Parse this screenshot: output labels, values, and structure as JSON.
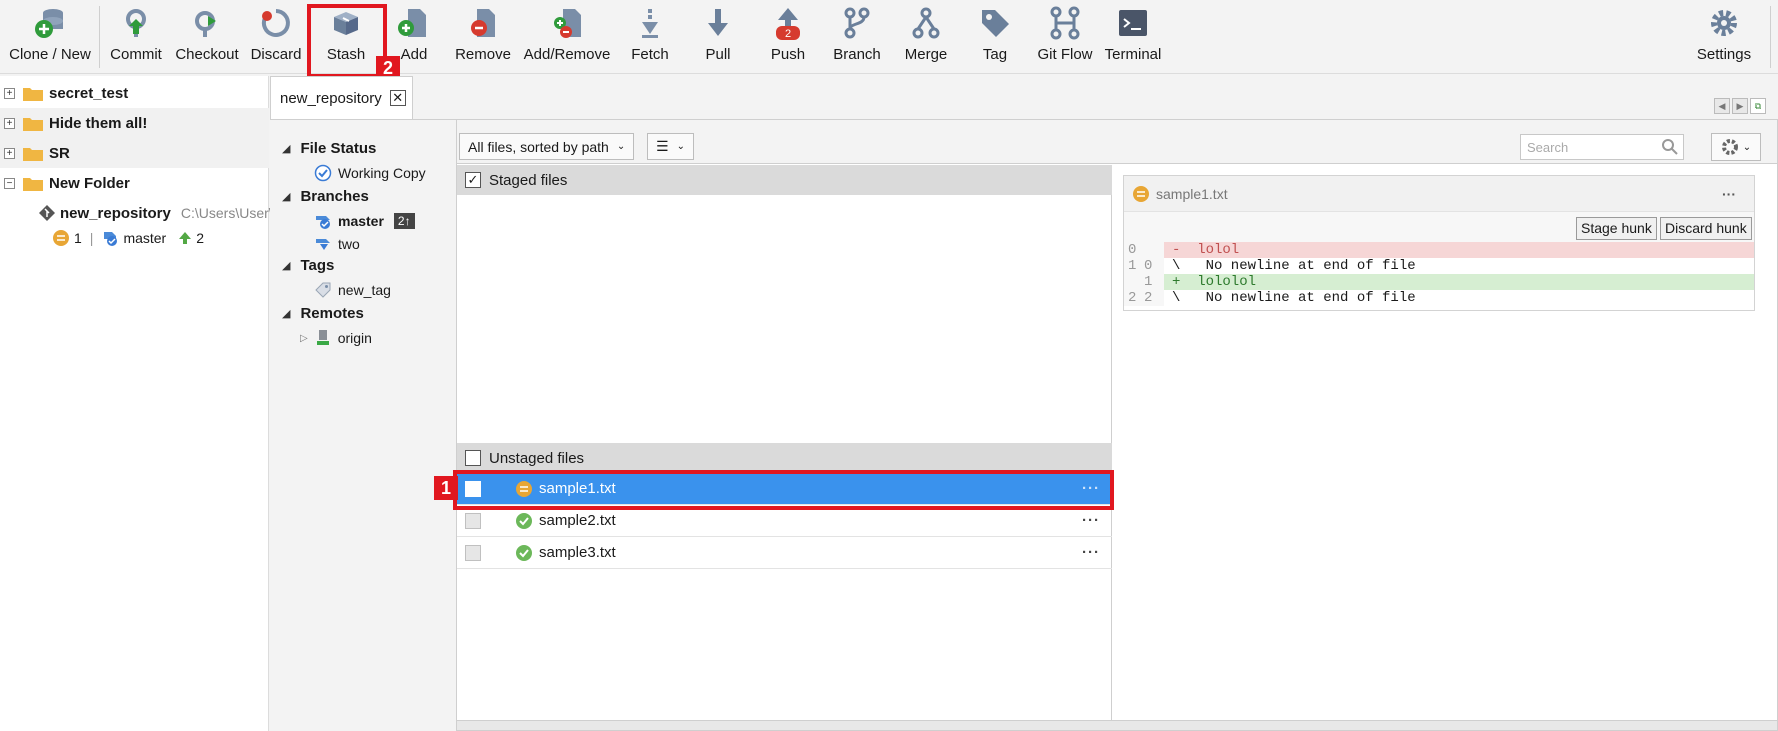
{
  "toolbar": {
    "buttons": [
      {
        "id": "clone",
        "label": "Clone / New"
      },
      {
        "id": "commit",
        "label": "Commit"
      },
      {
        "id": "checkout",
        "label": "Checkout"
      },
      {
        "id": "discard",
        "label": "Discard"
      },
      {
        "id": "stash",
        "label": "Stash"
      },
      {
        "id": "add",
        "label": "Add"
      },
      {
        "id": "remove",
        "label": "Remove"
      },
      {
        "id": "addremove",
        "label": "Add/Remove"
      },
      {
        "id": "fetch",
        "label": "Fetch"
      },
      {
        "id": "pull",
        "label": "Pull"
      },
      {
        "id": "push",
        "label": "Push",
        "badge": "2"
      },
      {
        "id": "branch",
        "label": "Branch"
      },
      {
        "id": "merge",
        "label": "Merge"
      },
      {
        "id": "tag",
        "label": "Tag"
      },
      {
        "id": "gitflow",
        "label": "Git Flow"
      },
      {
        "id": "terminal",
        "label": "Terminal"
      },
      {
        "id": "settings",
        "label": "Settings"
      }
    ]
  },
  "annotations": {
    "stash_step": "2",
    "file_step": "1",
    "color": "#e1171f"
  },
  "repo_tree": {
    "folders": [
      "secret_test",
      "Hide them all!",
      "SR",
      "New Folder"
    ],
    "expand_symbols": [
      "+",
      "+",
      "+",
      "−"
    ],
    "repo": {
      "name": "new_repository",
      "path": "C:\\Users\\User\\",
      "modified_count": "1",
      "separator": "|",
      "branch": "master",
      "ahead": "2"
    }
  },
  "tab": {
    "label": "new_repository",
    "close": "✕"
  },
  "sidebar": {
    "file_status": {
      "title": "File Status",
      "items": [
        "Working Copy"
      ]
    },
    "branches": {
      "title": "Branches",
      "items": [
        {
          "name": "master",
          "badge": "2↑",
          "current": true
        },
        {
          "name": "two"
        }
      ]
    },
    "tags": {
      "title": "Tags",
      "items": [
        "new_tag"
      ]
    },
    "remotes": {
      "title": "Remotes",
      "items": [
        "origin"
      ]
    }
  },
  "filter": {
    "sort_label": "All files, sorted by path",
    "search_placeholder": "Search"
  },
  "staged": {
    "title": "Staged files",
    "checked": "✓"
  },
  "unstaged": {
    "title": "Unstaged files",
    "files": [
      {
        "name": "sample1.txt",
        "status": "modified",
        "more": "···"
      },
      {
        "name": "sample2.txt",
        "status": "clean",
        "more": "···"
      },
      {
        "name": "sample3.txt",
        "status": "clean",
        "more": "···"
      }
    ]
  },
  "diff": {
    "filename": "sample1.txt",
    "more": "···",
    "stage_hunk": "Stage hunk",
    "discard_hunk": "Discard hunk",
    "lines": [
      {
        "old": "0",
        "new": "",
        "type": "del",
        "text": "-  lolol"
      },
      {
        "old": "1",
        "new": "0",
        "type": "ctx",
        "text": "\\   No newline at end of file"
      },
      {
        "old": "",
        "new": "1",
        "type": "add",
        "text": "+  lololol"
      },
      {
        "old": "2",
        "new": "2",
        "type": "ctx",
        "text": "\\   No newline at end of file"
      }
    ]
  },
  "colors": {
    "selection": "#3a92ed",
    "del_bg": "#f6d6d6",
    "add_bg": "#d6eed2",
    "highlight": "#e1171f"
  }
}
